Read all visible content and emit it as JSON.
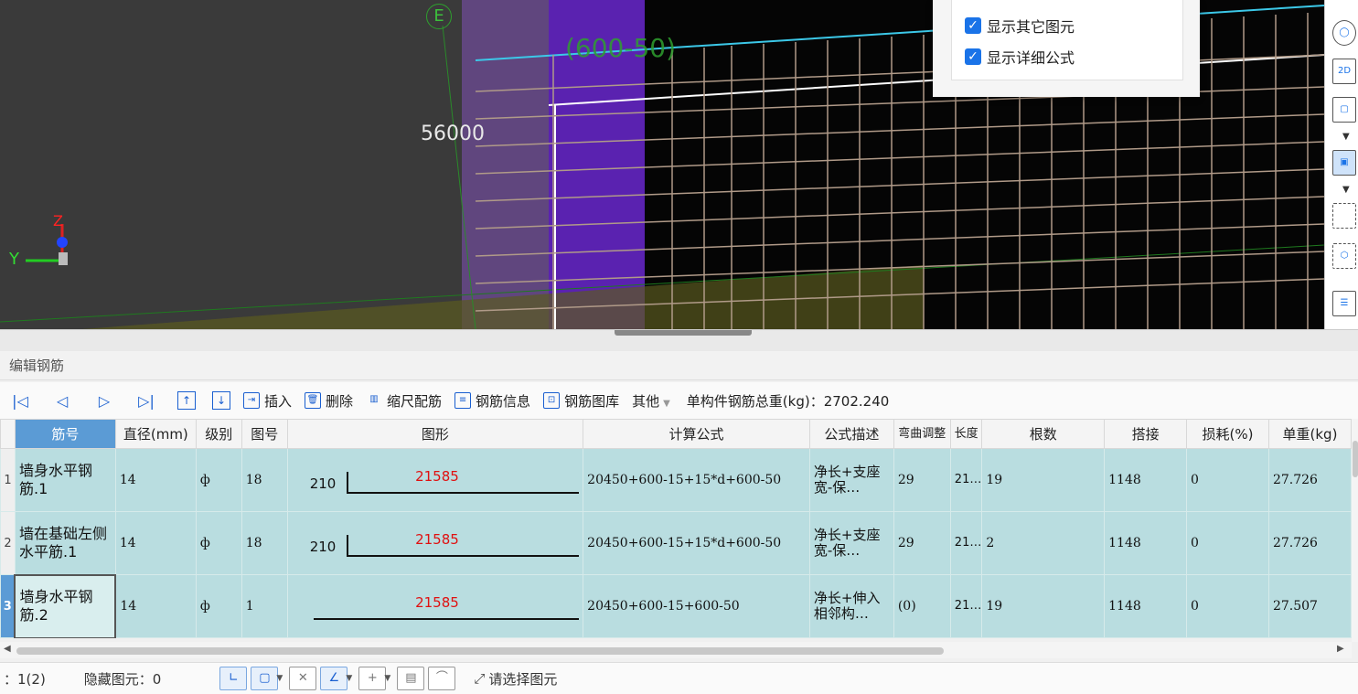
{
  "viewport": {
    "dim_label": "56000",
    "axis_bubble": "E",
    "dim_green": "(600-50)",
    "axis_y": "Y",
    "axis_z": "Z",
    "options": [
      {
        "label": "显示其它图元",
        "checked": true
      },
      {
        "label": "显示详细公式",
        "checked": true
      }
    ],
    "right_tools": [
      "orbit-icon",
      "view-2d-icon",
      "view-3d-box-icon",
      "solid-box-icon",
      "select-rect-icon",
      "element-visibility-icon",
      "list-settings-icon"
    ],
    "right_tool_text": {
      "view2d": "2D"
    }
  },
  "panel": {
    "title": "编辑钢筋"
  },
  "toolbar": {
    "nav": [
      "|◁",
      "◁",
      "▷",
      "▷|"
    ],
    "move_up": "↑",
    "move_down": "↓",
    "insert": "插入",
    "delete": "删除",
    "scale": "缩尺配筋",
    "info": "钢筋信息",
    "library": "钢筋图库",
    "other": "其他",
    "weight_label": "单构件钢筋总重(kg)：2702.240"
  },
  "table": {
    "columns": [
      "筋号",
      "直径(mm)",
      "级别",
      "图号",
      "图形",
      "计算公式",
      "公式描述",
      "弯曲调整",
      "长度",
      "根数",
      "搭接",
      "损耗(%)",
      "单重(kg)"
    ],
    "rows": [
      {
        "no": "1",
        "name": "墙身水平钢筋.1",
        "dia": "14",
        "grade": "ф",
        "fig": "18",
        "hook": "210",
        "len": "21585",
        "formula": "20450+600-15+15*d+600-50",
        "desc": "净长+支座宽-保…",
        "bend": "29",
        "length": "21…",
        "count": "19",
        "lap": "1148",
        "loss": "0",
        "weight": "27.726"
      },
      {
        "no": "2",
        "name": "墙在基础左侧水平筋.1",
        "dia": "14",
        "grade": "ф",
        "fig": "18",
        "hook": "210",
        "len": "21585",
        "formula": "20450+600-15+15*d+600-50",
        "desc": "净长+支座宽-保…",
        "bend": "29",
        "length": "21…",
        "count": "2",
        "lap": "1148",
        "loss": "0",
        "weight": "27.726"
      },
      {
        "no": "3",
        "name": "墙身水平钢筋.2",
        "dia": "14",
        "grade": "ф",
        "fig": "1",
        "hook": "",
        "len": "21585",
        "formula": "20450+600-15+600-50",
        "desc": "净长+伸入相邻构…",
        "bend": "(0)",
        "length": "21…",
        "count": "19",
        "lap": "1148",
        "loss": "0",
        "weight": "27.507"
      }
    ]
  },
  "status": {
    "selected": "：1(2)",
    "hidden": "隐藏图元：0",
    "prompt": "请选择图元"
  }
}
